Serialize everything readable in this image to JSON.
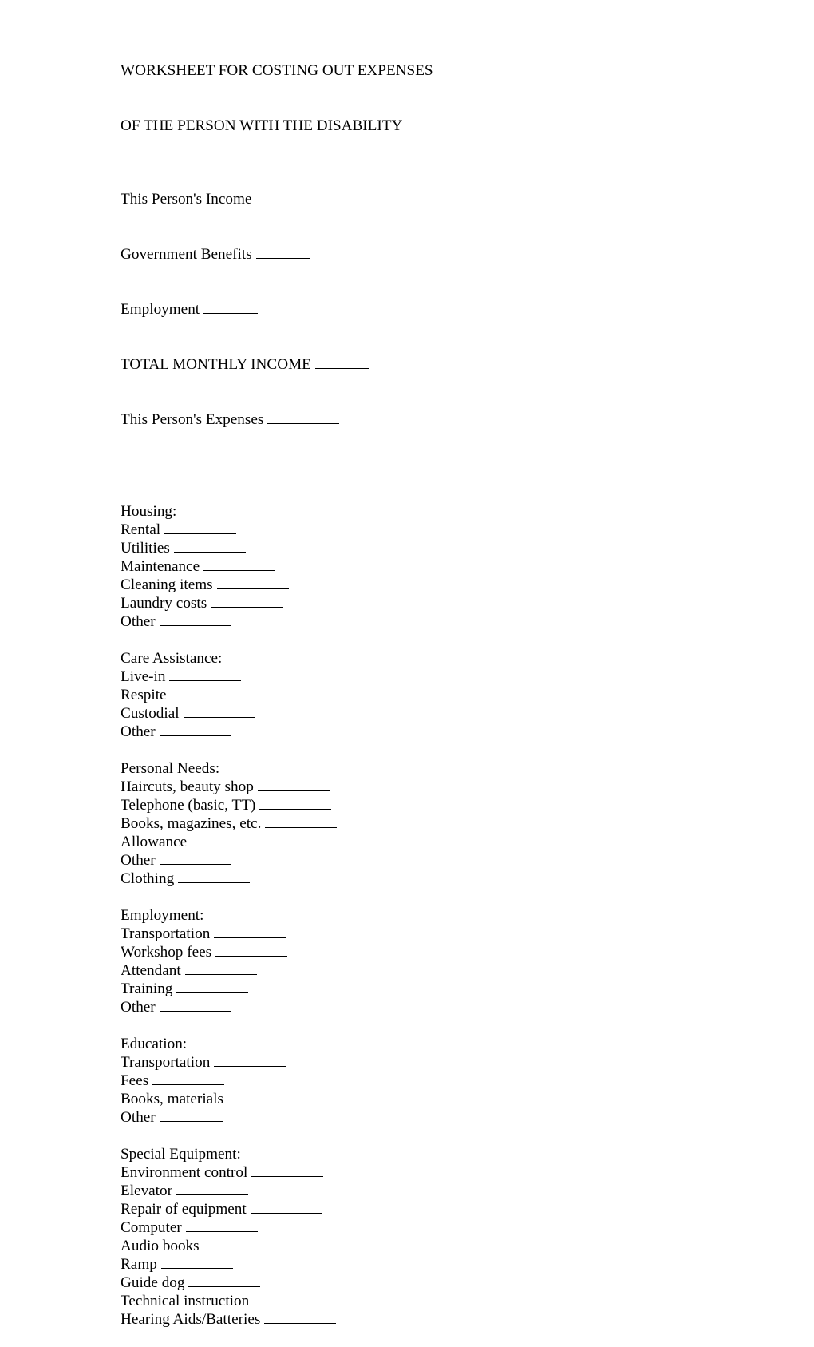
{
  "document": {
    "title_line_1": "WORKSHEET FOR COSTING OUT EXPENSES",
    "title_line_2": "OF THE PERSON WITH THE DISABILITY"
  },
  "income": {
    "heading": "This Person's Income",
    "fields": [
      {
        "label": "Government Benefits",
        "value": ""
      },
      {
        "label": "Employment",
        "value": ""
      },
      {
        "label": "TOTAL MONTHLY INCOME",
        "value": ""
      }
    ]
  },
  "expenses_total": {
    "label": "This Person's Expenses",
    "value": ""
  },
  "sections": [
    {
      "heading": "Housing:",
      "fields": [
        {
          "label": "Rental",
          "value": ""
        },
        {
          "label": "Utilities",
          "value": ""
        },
        {
          "label": "Maintenance",
          "value": ""
        },
        {
          "label": "Cleaning items",
          "value": ""
        },
        {
          "label": "Laundry costs",
          "value": ""
        },
        {
          "label": "Other",
          "value": ""
        }
      ]
    },
    {
      "heading": "Care Assistance:",
      "fields": [
        {
          "label": "Live-in",
          "value": ""
        },
        {
          "label": "Respite",
          "value": ""
        },
        {
          "label": "Custodial",
          "value": ""
        },
        {
          "label": "Other",
          "value": ""
        }
      ]
    },
    {
      "heading": "Personal Needs:",
      "fields": [
        {
          "label": "Haircuts, beauty shop",
          "value": ""
        },
        {
          "label": "Telephone (basic, TT)",
          "value": ""
        },
        {
          "label": "Books, magazines, etc.",
          "value": ""
        },
        {
          "label": "Allowance",
          "value": ""
        },
        {
          "label": "Other",
          "value": ""
        },
        {
          "label": "Clothing",
          "value": ""
        }
      ]
    },
    {
      "heading": "Employment:",
      "fields": [
        {
          "label": "Transportation",
          "value": ""
        },
        {
          "label": "Workshop fees",
          "value": ""
        },
        {
          "label": "Attendant",
          "value": ""
        },
        {
          "label": "Training",
          "value": ""
        },
        {
          "label": "Other",
          "value": ""
        }
      ]
    },
    {
      "heading": "Education:",
      "fields": [
        {
          "label": "Transportation",
          "value": ""
        },
        {
          "label": "Fees",
          "value": ""
        },
        {
          "label": "Books, materials",
          "value": ""
        },
        {
          "label": "Other",
          "value": ""
        }
      ]
    },
    {
      "heading": "Special Equipment:",
      "fields": [
        {
          "label": "Environment control",
          "value": ""
        },
        {
          "label": "Elevator",
          "value": ""
        },
        {
          "label": "Repair of equipment",
          "value": ""
        },
        {
          "label": "Computer",
          "value": ""
        },
        {
          "label": "Audio books",
          "value": ""
        },
        {
          "label": "Ramp",
          "value": ""
        },
        {
          "label": "Guide dog",
          "value": ""
        },
        {
          "label": "Technical instruction",
          "value": ""
        },
        {
          "label": "Hearing Aids/Batteries",
          "value": ""
        }
      ]
    }
  ]
}
